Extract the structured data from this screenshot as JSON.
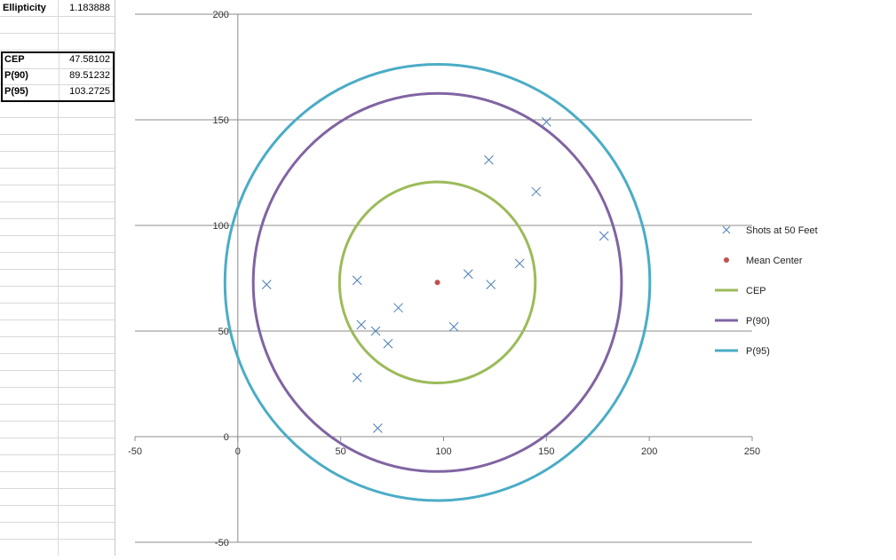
{
  "sheet": {
    "ellipticity_label": "Ellipticity",
    "ellipticity_value": "1.183888",
    "stats": [
      {
        "label": "CEP",
        "value": "47.58102"
      },
      {
        "label": "P(90)",
        "value": "89.51232"
      },
      {
        "label": "P(95)",
        "value": "103.2725"
      }
    ]
  },
  "chart_data": {
    "type": "scatter",
    "title": "",
    "xlabel": "",
    "ylabel": "",
    "xlim": [
      -50,
      250
    ],
    "ylim": [
      -50,
      200
    ],
    "x_ticks": [
      -50,
      0,
      50,
      100,
      150,
      200,
      250
    ],
    "y_ticks": [
      -50,
      0,
      50,
      100,
      150,
      200
    ],
    "gridlines": "horizontal major",
    "legend_position": "right",
    "series": [
      {
        "name": "Shots at 50 Feet",
        "marker": "x",
        "color": "#4a7ebb",
        "points": [
          [
            14,
            72
          ],
          [
            58,
            74
          ],
          [
            60,
            53
          ],
          [
            67,
            50
          ],
          [
            73,
            44
          ],
          [
            78,
            61
          ],
          [
            58,
            28
          ],
          [
            68,
            4
          ],
          [
            105,
            52
          ],
          [
            112,
            77
          ],
          [
            123,
            72
          ],
          [
            137,
            82
          ],
          [
            122,
            131
          ],
          [
            145,
            116
          ],
          [
            150,
            149
          ],
          [
            178,
            95
          ]
        ]
      },
      {
        "name": "Mean Center",
        "marker": "dot",
        "color": "#c0504d",
        "points": [
          [
            97,
            73
          ]
        ]
      },
      {
        "name": "CEP",
        "type": "circle",
        "color": "#9bbb59",
        "center": [
          97,
          73
        ],
        "radius": 47.58102
      },
      {
        "name": "P(90)",
        "type": "circle",
        "color": "#8064a2",
        "center": [
          97,
          73
        ],
        "radius": 89.51232
      },
      {
        "name": "P(95)",
        "type": "circle",
        "color": "#4bacc6",
        "center": [
          97,
          73
        ],
        "radius": 103.2725
      }
    ]
  }
}
